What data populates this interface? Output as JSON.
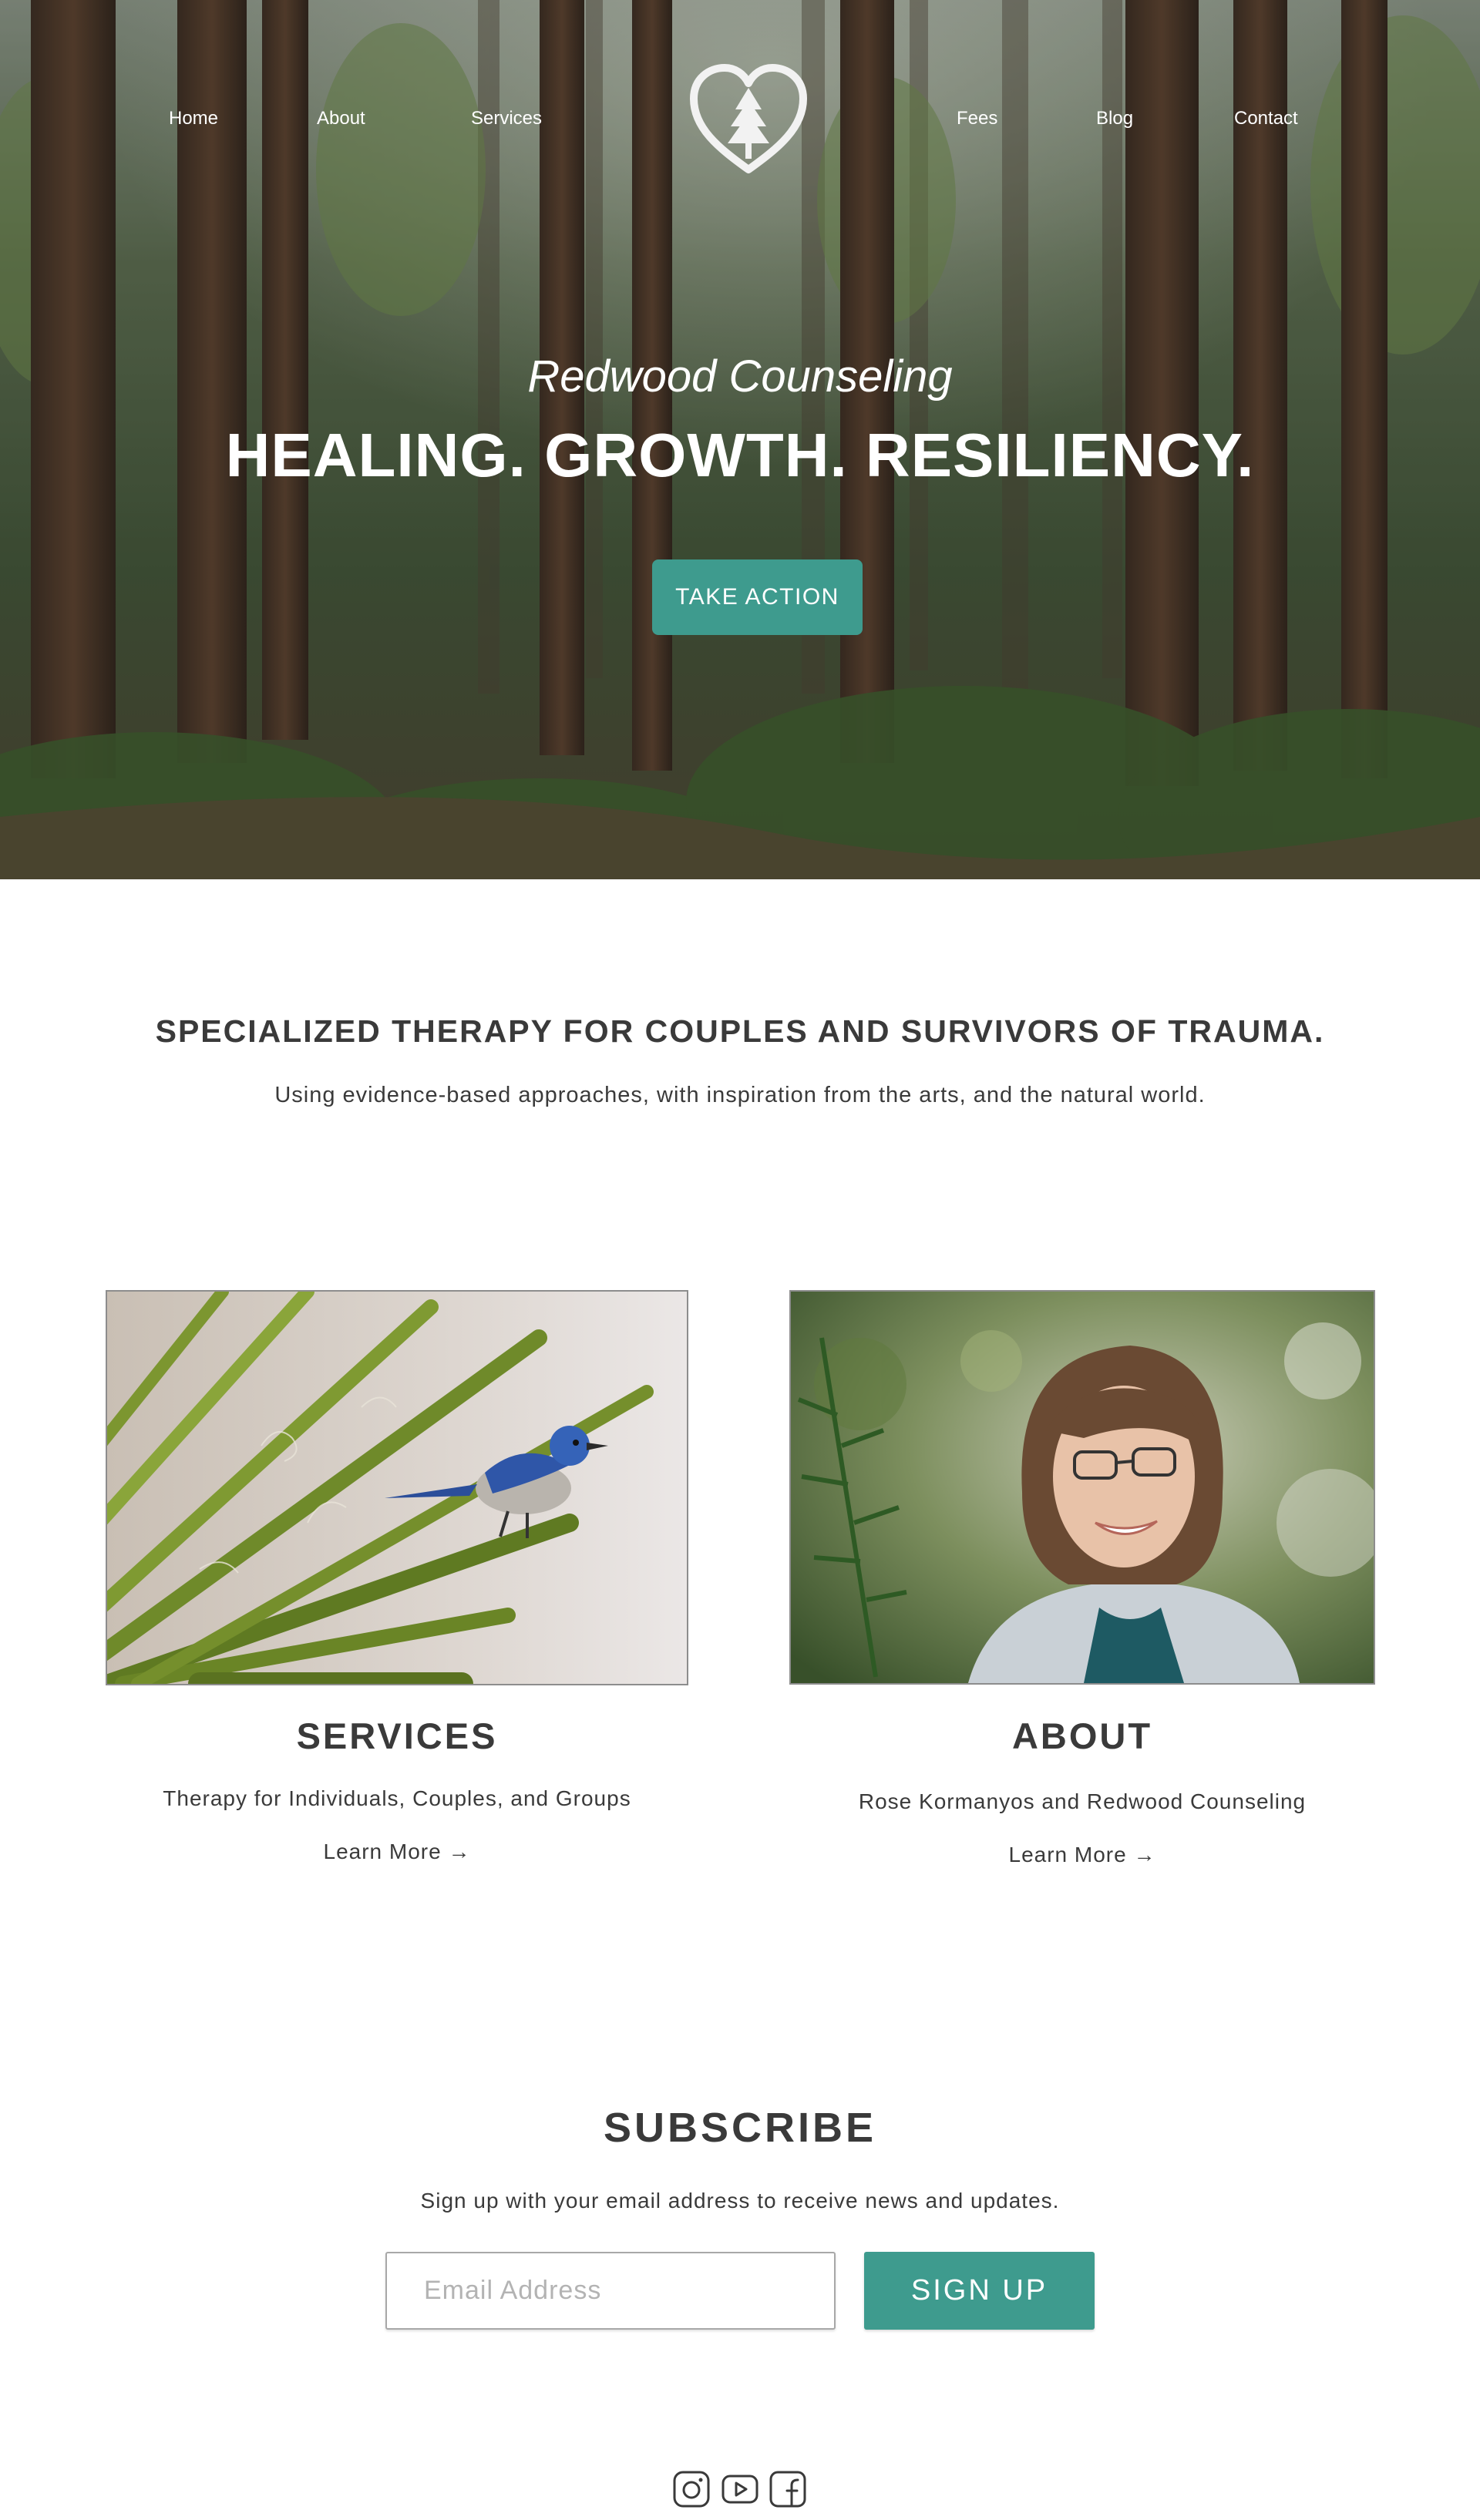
{
  "nav": {
    "left": [
      "Home",
      "About",
      "Services"
    ],
    "right": [
      "Fees",
      "Blog",
      "Contact"
    ],
    "logo_icon": "heart-redwood-tree-logo"
  },
  "hero": {
    "tagline": "Redwood Counseling",
    "title": "HEALING. GROWTH. RESILIENCY.",
    "cta_label": "TAKE ACTION"
  },
  "intro": {
    "heading": "SPECIALIZED THERAPY FOR COUPLES AND SURVIVORS OF TRAUMA.",
    "subheading": "Using evidence-based approaches, with inspiration from the arts, and the natural world."
  },
  "cards": [
    {
      "title": "SERVICES",
      "text": "Therapy for Individuals, Couples, and Groups",
      "link": "Learn More →",
      "image": "blue-jay-on-yucca-photo"
    },
    {
      "title": "ABOUT",
      "text": "Rose Kormanyos and Redwood Counseling",
      "link": "Learn More →",
      "image": "therapist-portrait-photo"
    }
  ],
  "subscribe": {
    "heading": "SUBSCRIBE",
    "text": "Sign up with your email address to receive news and updates.",
    "email_placeholder": "Email Address",
    "button_label": "SIGN UP"
  },
  "social": [
    "instagram-icon",
    "youtube-icon",
    "facebook-icon"
  ],
  "colors": {
    "accent": "#3e9b8e",
    "text": "#3a3a3a",
    "nav_text": "#ffffff"
  }
}
